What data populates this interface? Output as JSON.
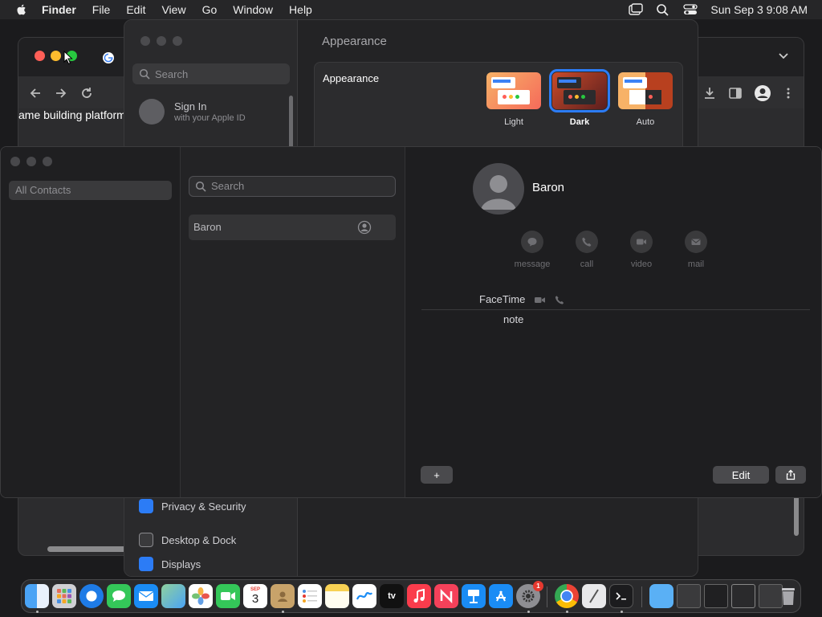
{
  "menubar": {
    "app_name": "Finder",
    "items": [
      "File",
      "Edit",
      "View",
      "Go",
      "Window",
      "Help"
    ],
    "datetime": "Sun Sep 3  9:08 AM"
  },
  "browser": {
    "page_text": "ame building platform"
  },
  "settings": {
    "search_placeholder": "Search",
    "signin_title": "Sign In",
    "signin_subtitle": "with your Apple ID",
    "pane_title": "Appearance",
    "group_label": "Appearance",
    "themes": [
      {
        "name": "Light",
        "selected": false
      },
      {
        "name": "Dark",
        "selected": true
      },
      {
        "name": "Auto",
        "selected": false
      }
    ],
    "sidebar_items": [
      "Privacy & Security",
      "Desktop & Dock",
      "Displays"
    ]
  },
  "contacts": {
    "group_all": "All Contacts",
    "search_placeholder": "Search",
    "list_items": [
      "Baron"
    ],
    "detail": {
      "name": "Baron",
      "actions": [
        "message",
        "call",
        "video",
        "mail"
      ],
      "facetime_label": "FaceTime",
      "note_label": "note"
    },
    "add_label": "+",
    "edit_label": "Edit"
  },
  "dock": {
    "calendar_month": "SEP",
    "calendar_day": "3",
    "tv_label": "tv",
    "settings_badge": "1",
    "icons": [
      "finder-icon",
      "launchpad-icon",
      "safari-icon",
      "messages-icon",
      "mail-icon",
      "maps-icon",
      "photos-icon",
      "facetime-icon",
      "calendar-icon",
      "contacts-icon",
      "reminders-icon",
      "notes-icon",
      "freeform-icon",
      "apple-tv-icon",
      "music-icon",
      "news-icon",
      "keynote-icon",
      "app-store-icon",
      "system-settings-icon",
      "chrome-icon",
      "script-editor-icon",
      "terminal-icon",
      "downloads-folder-icon",
      "trash-icon"
    ]
  },
  "colors": {
    "accent": "#2c7cf6",
    "close": "#ff5f57",
    "minimize": "#febc2e",
    "zoom": "#28c840"
  }
}
